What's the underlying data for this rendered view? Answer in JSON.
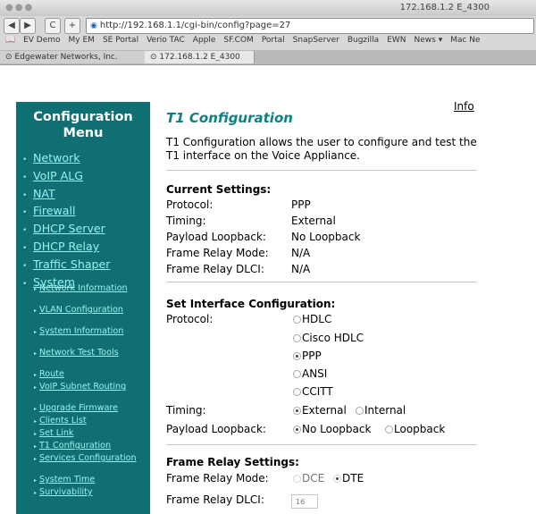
{
  "browser": {
    "window_title": "172.168.1.2 E_4300",
    "url": "http://192.168.1.1/cgi-bin/config?page=27",
    "nav": {
      "back": "◀",
      "forward": "▶",
      "reload": "C",
      "add": "+"
    },
    "bookmarks": [
      "EV Demo",
      "My EM",
      "SE Portal",
      "Verio TAC",
      "Apple",
      "SF.COM",
      "Portal",
      "SnapServer",
      "Bugzilla",
      "EWN",
      "News ▾",
      "Mac Ne"
    ],
    "tabs": [
      {
        "label": "Edgewater Networks, Inc.",
        "active": false
      },
      {
        "label": "172.168.1.2 E_4300",
        "active": true
      }
    ]
  },
  "sidebar": {
    "title": "Configuration Menu",
    "items": [
      "Network",
      "VoIP ALG",
      "NAT",
      "Firewall",
      "DHCP Server",
      "DHCP Relay",
      "Traffic Shaper",
      "System"
    ],
    "subitems": [
      "Network Information",
      "VLAN Configuration",
      "System Information",
      "Network Test Tools",
      "Route",
      "VoIP Subnet Routing",
      "Upgrade Firmware",
      "Clients List",
      "Set Link",
      "T1 Configuration",
      "Services Configuration",
      "System Time",
      "Survivability"
    ]
  },
  "content": {
    "info_link": "Info",
    "title": "T1 Configuration",
    "description": "T1 Configuration allows the user to configure and test the T1 interface on the Voice Appliance.",
    "current": {
      "heading": "Current Settings:",
      "rows": [
        {
          "label": "Protocol:",
          "value": "PPP"
        },
        {
          "label": "Timing:",
          "value": "External"
        },
        {
          "label": "Payload Loopback:",
          "value": "No Loopback"
        },
        {
          "label": "Frame Relay Mode:",
          "value": "N/A"
        },
        {
          "label": "Frame Relay DLCI:",
          "value": "N/A"
        }
      ]
    },
    "set_interface": {
      "heading": "Set Interface Configuration:",
      "protocol_label": "Protocol:",
      "protocols": [
        "HDLC",
        "Cisco HDLC",
        "PPP",
        "ANSI",
        "CCITT"
      ],
      "protocol_selected": "PPP",
      "timing_label": "Timing:",
      "timing_options": [
        "External",
        "Internal"
      ],
      "timing_selected": "External",
      "loopback_label": "Payload Loopback:",
      "loopback_options": [
        "No Loopback",
        "Loopback"
      ],
      "loopback_selected": "No Loopback"
    },
    "frame_relay": {
      "heading": "Frame Relay Settings:",
      "mode_label": "Frame Relay Mode:",
      "mode_options": [
        "DCE",
        "DTE"
      ],
      "mode_selected": "DTE",
      "dlci_label": "Frame Relay DLCI:",
      "dlci_value": "16"
    }
  },
  "colors": {
    "sidebar_bg": "#106f73",
    "link": "#9af0f0",
    "title": "#108080"
  }
}
